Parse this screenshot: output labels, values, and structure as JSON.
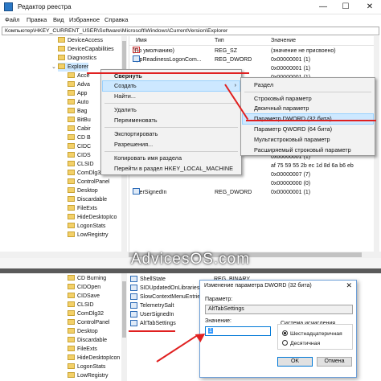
{
  "window": {
    "title": "Редактор реестра",
    "minimize": "—",
    "maximize": "☐",
    "close": "✕"
  },
  "menu": [
    "Файл",
    "Правка",
    "Вид",
    "Избранное",
    "Справка"
  ],
  "address": "Компьютер\\HKEY_CURRENT_USER\\Software\\Microsoft\\Windows\\CurrentVersion\\Explorer",
  "tree_top": [
    {
      "label": "DeviceAccess"
    },
    {
      "label": "DeviceCapabilities"
    },
    {
      "label": "Diagnostics"
    },
    {
      "label": "Explorer"
    },
    {
      "label": "Acce"
    },
    {
      "label": "Adva"
    },
    {
      "label": "App"
    },
    {
      "label": "Auto"
    },
    {
      "label": "Bag"
    },
    {
      "label": "BitBu"
    },
    {
      "label": "Cabir"
    },
    {
      "label": "CD B"
    },
    {
      "label": "CIDC"
    },
    {
      "label": "CIDS"
    },
    {
      "label": "CLSID"
    },
    {
      "label": "ComDlg32"
    },
    {
      "label": "ControlPanel"
    },
    {
      "label": "Desktop"
    },
    {
      "label": "Discardable"
    },
    {
      "label": "FileExts"
    },
    {
      "label": "HideDesktopIco"
    },
    {
      "label": "LogonStats"
    },
    {
      "label": "LowRegistry"
    }
  ],
  "list": {
    "headers": {
      "name": "Имя",
      "type": "Тип",
      "data": "Значение"
    },
    "rows": [
      {
        "name": "(По умолчанию)",
        "type": "REG_SZ",
        "data": "(значение не присвоено)",
        "icon": "ab"
      },
      {
        "name": "AppReadinessLogonCom...",
        "type": "REG_DWORD",
        "data": "0x00000001 (1)",
        "icon": "bin"
      },
      {
        "name": "",
        "type": "",
        "data": "0x00000001 (1)",
        "icon": ""
      },
      {
        "name": "",
        "type": "",
        "data": "0x00000001 (1)",
        "icon": ""
      },
      {
        "name": "",
        "type": "",
        "data": "0x00000001 (1)",
        "icon": ""
      },
      {
        "name": "",
        "type": "",
        "data": "0x00000001 (1)",
        "icon": ""
      },
      {
        "name": "",
        "type": "",
        "data": "0x00000001 (1)",
        "icon": ""
      },
      {
        "name": "",
        "type": "",
        "data": "0x00000001 (1)",
        "icon": ""
      },
      {
        "name": "",
        "type": "",
        "data": "0x00000001 (1)",
        "icon": ""
      },
      {
        "name": "",
        "type": "",
        "data": "0x00000001 (1)",
        "icon": ""
      },
      {
        "name": "",
        "type": "",
        "data": "0x00000000 (0)",
        "icon": ""
      },
      {
        "name": "",
        "type": "",
        "data": "0x00000001 (1)",
        "icon": ""
      },
      {
        "name": "",
        "type": "",
        "data": "0x00000001 (1)",
        "icon": ""
      },
      {
        "name": "",
        "type": "",
        "data": "af 75 59 55 2b ec 1d 8d 6a b6 eb",
        "icon": ""
      },
      {
        "name": "",
        "type": "",
        "data": "0x00000007 (7)",
        "icon": ""
      },
      {
        "name": "",
        "type": "",
        "data": "0x00000000 (0)",
        "icon": ""
      },
      {
        "name": "UserSignedIn",
        "type": "REG_DWORD",
        "data": "0x00000001 (1)",
        "icon": "bin"
      }
    ]
  },
  "context_menu": {
    "items": [
      {
        "label": "Свернуть",
        "bold": true
      },
      {
        "label": "Создать",
        "submenu": true
      },
      {
        "label": "Найти..."
      },
      {
        "label": "Удалить"
      },
      {
        "label": "Переименовать"
      },
      {
        "label": "Экспортировать"
      },
      {
        "label": "Разрешения..."
      },
      {
        "label": "Копировать имя раздела"
      },
      {
        "label": "Перейти в раздел HKEY_LOCAL_MACHINE"
      }
    ],
    "submenu_arrow": "›"
  },
  "submenu": {
    "items": [
      {
        "label": "Раздел"
      },
      {
        "label": "Строковый параметр"
      },
      {
        "label": "Двоичный параметр"
      },
      {
        "label": "Параметр DWORD (32 бита)"
      },
      {
        "label": "Параметр QWORD (64 бита)"
      },
      {
        "label": "Мультистроковый параметр"
      },
      {
        "label": "Расширяемый строковый параметр"
      }
    ]
  },
  "watermark": "AdvicesOS.com",
  "tree_bottom": [
    {
      "label": "CD Burning"
    },
    {
      "label": "CIDOpen"
    },
    {
      "label": "CIDSave"
    },
    {
      "label": "CLSID"
    },
    {
      "label": "ComDlg32"
    },
    {
      "label": "ControlPanel"
    },
    {
      "label": "Desktop"
    },
    {
      "label": "Discardable"
    },
    {
      "label": "FileExts"
    },
    {
      "label": "HideDesktopIcon"
    },
    {
      "label": "LogonStats"
    },
    {
      "label": "LowRegistry"
    }
  ],
  "list_bottom": [
    {
      "name": "ShellState",
      "type": "REG_BINARY"
    },
    {
      "name": "SIDUpdatedOnLibraries",
      "type": ""
    },
    {
      "name": "SlowContextMenuEntrie",
      "type": ""
    },
    {
      "name": "TelemetrySalt",
      "type": ""
    },
    {
      "name": "UserSignedIn",
      "type": ""
    },
    {
      "name": "AltTabSettings",
      "type": ""
    }
  ],
  "dialog": {
    "title": "Изменение параметра DWORD (32 бита)",
    "close": "✕",
    "param_label": "Параметр:",
    "param_value": "AltTabSettings",
    "value_label": "Значение:",
    "value": "1",
    "base_label": "Система исчисления",
    "hex_label": "Шестнадцатеричная",
    "dec_label": "Десятичная",
    "ok": "OK",
    "cancel": "Отмена"
  },
  "colors": {
    "accent_red": "#e02020",
    "selection": "#cde8ff",
    "dialog_border": "#6d9fd8"
  }
}
